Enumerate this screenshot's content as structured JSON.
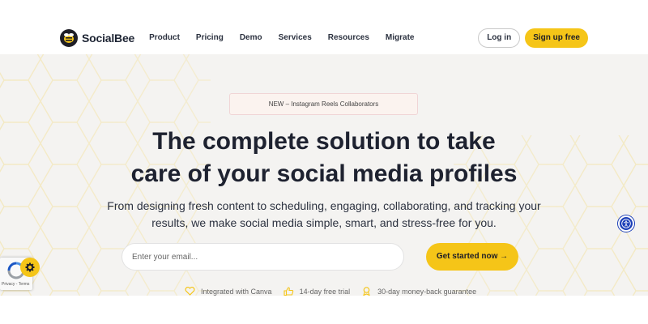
{
  "brand": {
    "name": "SocialBee",
    "accent": "#f5c518"
  },
  "nav": {
    "links": [
      "Product",
      "Pricing",
      "Demo",
      "Services",
      "Resources",
      "Migrate"
    ],
    "login_label": "Log in",
    "signup_label": "Sign up free"
  },
  "hero": {
    "badge": "NEW – Instagram Reels Collaborators",
    "headline_line1": "The complete solution to take",
    "headline_line2": "care of your social media profiles",
    "subhead_line1": "From designing fresh content to scheduling, engaging, collaborating, and tracking your",
    "subhead_line2": "results, we make social media simple, smart, and stress-free for you.",
    "email_placeholder": "Enter your email...",
    "cta_label": "Get started now →",
    "features": [
      {
        "icon": "heart-icon",
        "label": "Integrated with Canva"
      },
      {
        "icon": "thumbs-up-icon",
        "label": "14-day free trial"
      },
      {
        "icon": "badge-icon",
        "label": "30-day money-back guarantee"
      }
    ]
  },
  "widgets": {
    "recaptcha_terms": "Privacy - Terms",
    "accessibility_icon": "accessibility-icon",
    "cookie_icon": "gear-icon"
  }
}
